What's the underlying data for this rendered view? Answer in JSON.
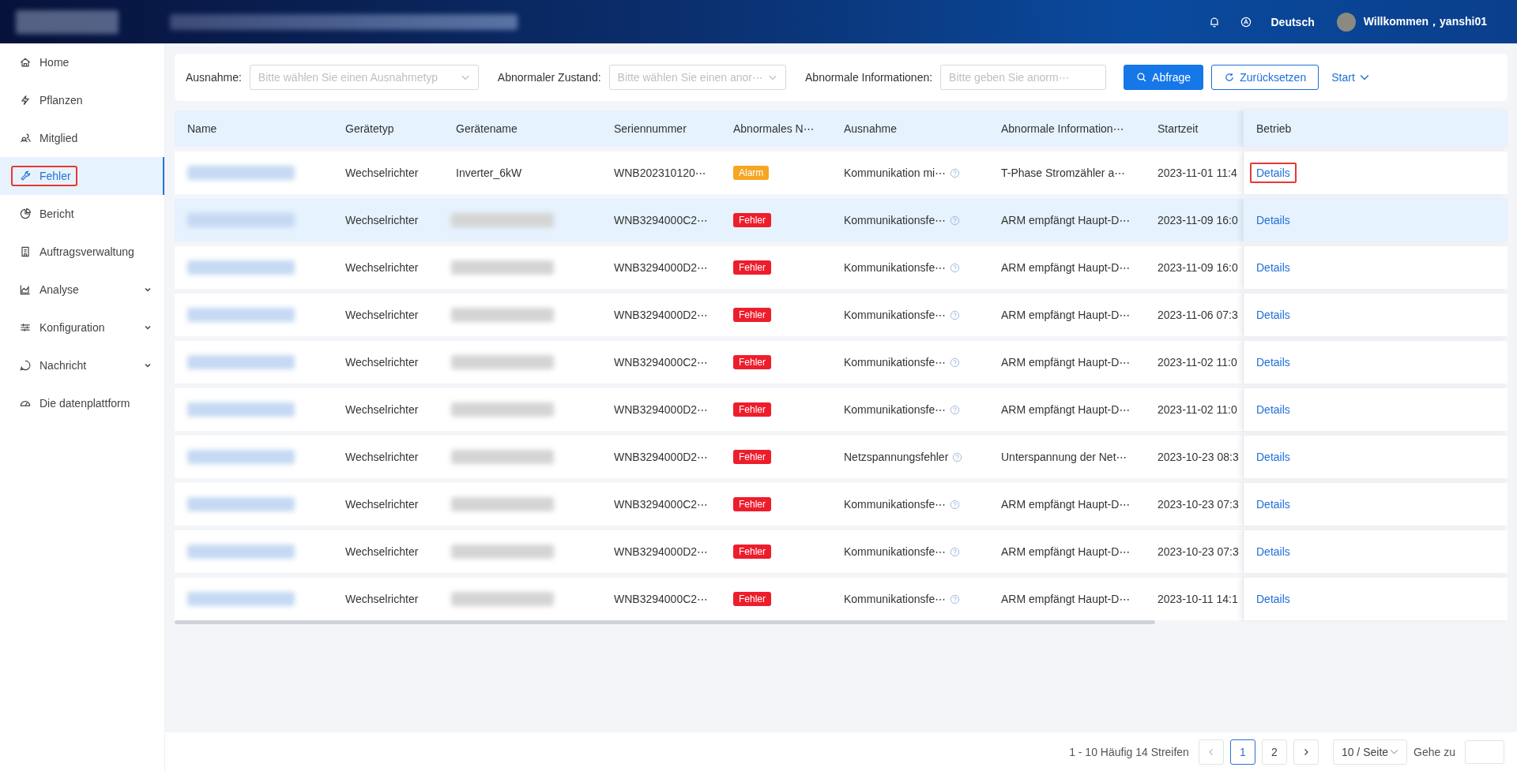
{
  "header": {
    "language": "Deutsch",
    "welcome": "Willkommen，yanshi01"
  },
  "sidebar": {
    "items": [
      {
        "label": "Home",
        "selected": false,
        "has_submenu": false,
        "annotated": false
      },
      {
        "label": "Pflanzen",
        "selected": false,
        "has_submenu": false,
        "annotated": false
      },
      {
        "label": "Mitglied",
        "selected": false,
        "has_submenu": false,
        "annotated": false
      },
      {
        "label": "Fehler",
        "selected": true,
        "has_submenu": false,
        "annotated": true
      },
      {
        "label": "Bericht",
        "selected": false,
        "has_submenu": false,
        "annotated": false
      },
      {
        "label": "Auftragsverwaltung",
        "selected": false,
        "has_submenu": false,
        "annotated": false
      },
      {
        "label": "Analyse",
        "selected": false,
        "has_submenu": true,
        "annotated": false
      },
      {
        "label": "Konfiguration",
        "selected": false,
        "has_submenu": true,
        "annotated": false
      },
      {
        "label": "Nachricht",
        "selected": false,
        "has_submenu": true,
        "annotated": false
      },
      {
        "label": "Die datenplattform",
        "selected": false,
        "has_submenu": false,
        "annotated": false
      }
    ]
  },
  "filters": [
    {
      "label": "Ausnahme:",
      "kind": "select",
      "placeholder": "Bitte wählen Sie einen Ausnahmetyp"
    },
    {
      "label": "Abnormaler Zustand:",
      "kind": "select",
      "placeholder": "Bitte wählen Sie einen anor⋯"
    },
    {
      "label": "Abnormale Informationen:",
      "kind": "input",
      "placeholder": "Bitte geben Sie anorm⋯"
    }
  ],
  "buttons": [
    {
      "label": "Abfrage",
      "kind": "primary"
    },
    {
      "label": "Zurücksetzen",
      "kind": "outline"
    },
    {
      "label": "Start",
      "kind": "link"
    }
  ],
  "table": {
    "columns": [
      "Name",
      "Gerätetyp",
      "Gerätename",
      "Seriennummer",
      "Abnormales N⋯",
      "Ausnahme",
      "Abnormale Information⋯",
      "Startzeit",
      "Betrieb"
    ],
    "rows": [
      {
        "selected": false,
        "type": "Wechselrichter",
        "device_name": "Inverter_6kW",
        "serial": "WNB202310120⋯",
        "status": {
          "label": "Alarm",
          "kind": "alarm"
        },
        "exception": "Kommunikation mi⋯",
        "info": "T-Phase Stromzähler a⋯",
        "start": "2023-11-01 11:4",
        "action": "Details",
        "annotated": true
      },
      {
        "selected": true,
        "type": "Wechselrichter",
        "serial": "WNB3294000C2⋯",
        "status": {
          "label": "Fehler",
          "kind": "error"
        },
        "exception": "Kommunikationsfe⋯",
        "info": "ARM empfängt Haupt-D⋯",
        "start": "2023-11-09 16:0",
        "action": "Details",
        "annotated": false
      },
      {
        "selected": false,
        "type": "Wechselrichter",
        "serial": "WNB3294000D2⋯",
        "status": {
          "label": "Fehler",
          "kind": "error"
        },
        "exception": "Kommunikationsfe⋯",
        "info": "ARM empfängt Haupt-D⋯",
        "start": "2023-11-09 16:0",
        "action": "Details",
        "annotated": false
      },
      {
        "selected": false,
        "type": "Wechselrichter",
        "serial": "WNB3294000D2⋯",
        "status": {
          "label": "Fehler",
          "kind": "error"
        },
        "exception": "Kommunikationsfe⋯",
        "info": "ARM empfängt Haupt-D⋯",
        "start": "2023-11-06 07:3",
        "action": "Details",
        "annotated": false
      },
      {
        "selected": false,
        "type": "Wechselrichter",
        "serial": "WNB3294000C2⋯",
        "status": {
          "label": "Fehler",
          "kind": "error"
        },
        "exception": "Kommunikationsfe⋯",
        "info": "ARM empfängt Haupt-D⋯",
        "start": "2023-11-02 11:0",
        "action": "Details",
        "annotated": false
      },
      {
        "selected": false,
        "type": "Wechselrichter",
        "serial": "WNB3294000D2⋯",
        "status": {
          "label": "Fehler",
          "kind": "error"
        },
        "exception": "Kommunikationsfe⋯",
        "info": "ARM empfängt Haupt-D⋯",
        "start": "2023-11-02 11:0",
        "action": "Details",
        "annotated": false
      },
      {
        "selected": false,
        "type": "Wechselrichter",
        "serial": "WNB3294000D2⋯",
        "status": {
          "label": "Fehler",
          "kind": "error"
        },
        "exception": "Netzspannungsfehler",
        "info": "Unterspannung der Net⋯",
        "start": "2023-10-23 08:3",
        "action": "Details",
        "annotated": false
      },
      {
        "selected": false,
        "type": "Wechselrichter",
        "serial": "WNB3294000C2⋯",
        "status": {
          "label": "Fehler",
          "kind": "error"
        },
        "exception": "Kommunikationsfe⋯",
        "info": "ARM empfängt Haupt-D⋯",
        "start": "2023-10-23 07:3",
        "action": "Details",
        "annotated": false
      },
      {
        "selected": false,
        "type": "Wechselrichter",
        "serial": "WNB3294000D2⋯",
        "status": {
          "label": "Fehler",
          "kind": "error"
        },
        "exception": "Kommunikationsfe⋯",
        "info": "ARM empfängt Haupt-D⋯",
        "start": "2023-10-23 07:3",
        "action": "Details",
        "annotated": false
      },
      {
        "selected": false,
        "type": "Wechselrichter",
        "serial": "WNB3294000C2⋯",
        "status": {
          "label": "Fehler",
          "kind": "error"
        },
        "exception": "Kommunikationsfe⋯",
        "info": "ARM empfängt Haupt-D⋯",
        "start": "2023-10-11 14:1",
        "action": "Details",
        "annotated": false
      }
    ]
  },
  "pagination": {
    "summary": "1 - 10 Häufig 14 Streifen",
    "pages": [
      {
        "label": "1",
        "selected": true
      },
      {
        "label": "2",
        "selected": false
      }
    ],
    "page_size": "10 / Seite",
    "goto_label": "Gehe zu"
  }
}
